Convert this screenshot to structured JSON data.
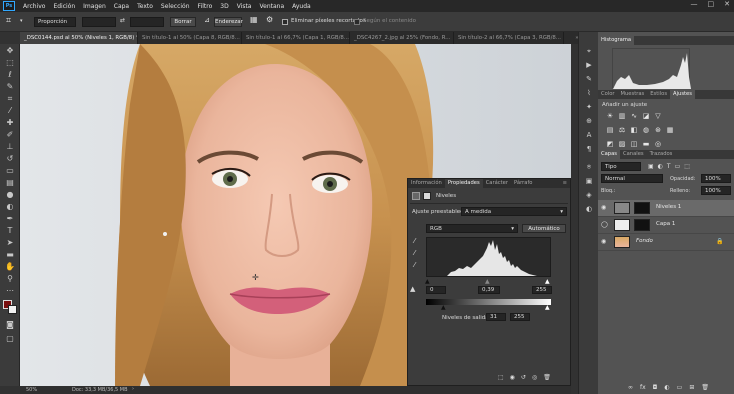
{
  "app": {
    "logo": "Ps",
    "menu": [
      "Archivo",
      "Edición",
      "Imagen",
      "Capa",
      "Texto",
      "Selección",
      "Filtro",
      "3D",
      "Vista",
      "Ventana",
      "Ayuda"
    ],
    "window_controls": [
      "—",
      "□",
      "✕"
    ]
  },
  "options_bar": {
    "mode_value": "Proporción",
    "clear_label": "Borrar",
    "straighten_label": "Enderezar",
    "delete_cropped_label": "Eliminar píxeles recortados",
    "content_aware_label": "Según el contenido"
  },
  "doc_tabs": [
    {
      "label": "_DSC0144.psd al 50% (Niveles 1, RGB/8) *",
      "active": true
    },
    {
      "label": "Sin título-1 al 50% (Capa 8, RGB/8...",
      "active": false
    },
    {
      "label": "Sin título-1 al 66,7% (Capa 1, RGB/8...",
      "active": false
    },
    {
      "label": "_DSC4267_2.jpg al 25% (Fondo, R...",
      "active": false
    },
    {
      "label": "Sin título-2 al 66,7% (Capa 3, RGB/8...",
      "active": false
    }
  ],
  "status": {
    "zoom": "50%",
    "doc_info": "Doc: 33,3 MB/36,5 MB"
  },
  "histogram_panel": {
    "title": "Histograma"
  },
  "adjustments_panel": {
    "tabs": [
      "Color",
      "Muestras",
      "Estilos",
      "Ajustes"
    ],
    "active_tab": "Ajustes",
    "heading": "Añadir un ajuste"
  },
  "layers_panel": {
    "tabs": [
      "Capas",
      "Canales",
      "Trazados"
    ],
    "filter_label": "Tipo",
    "blend_mode": "Normal",
    "opacity_label": "Opacidad:",
    "opacity_value": "100%",
    "lock_label": "Bloq.:",
    "fill_label": "Relleno:",
    "fill_value": "100%",
    "layers": [
      {
        "name": "Niveles 1",
        "selected": true
      },
      {
        "name": "Capa 1",
        "selected": false
      },
      {
        "name": "Fondo",
        "selected": false
      }
    ]
  },
  "properties_panel": {
    "tabs": [
      "Información",
      "Propiedades",
      "Carácter",
      "Párrafo"
    ],
    "active_tab": "Propiedades",
    "title": "Niveles",
    "preset_label": "Ajuste preestablecido:",
    "preset_value": "A medida",
    "channel": "RGB",
    "auto_label": "Automático",
    "input_black": "0",
    "input_gamma": "0,39",
    "input_white": "255",
    "output_label": "Niveles de salida:",
    "output_black": "31",
    "output_white": "255"
  }
}
